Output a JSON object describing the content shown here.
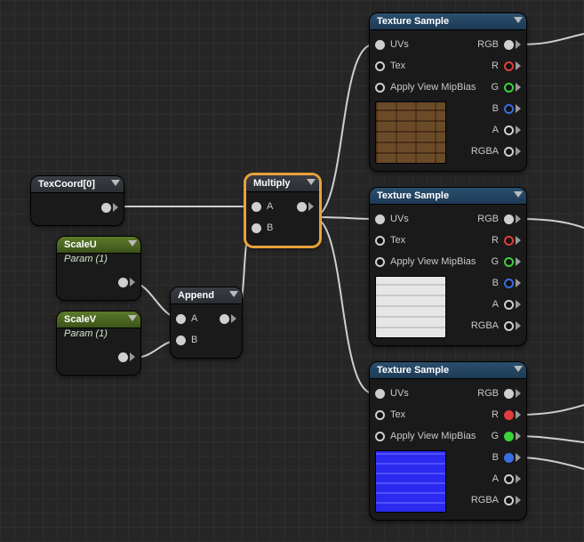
{
  "nodes": {
    "texcoord": {
      "title": "TexCoord[0]"
    },
    "scaleU": {
      "title": "ScaleU",
      "sub": "Param (1)"
    },
    "scaleV": {
      "title": "ScaleV",
      "sub": "Param (1)"
    },
    "append": {
      "title": "Append",
      "inA": "A",
      "inB": "B"
    },
    "multiply": {
      "title": "Multiply",
      "inA": "A",
      "inB": "B"
    },
    "txsample": {
      "title": "Texture Sample",
      "in_uvs": "UVs",
      "in_tex": "Tex",
      "in_mip": "Apply View MipBias",
      "out_rgb": "RGB",
      "out_r": "R",
      "out_g": "G",
      "out_b": "B",
      "out_a": "A",
      "out_rgba": "RGBA"
    }
  }
}
